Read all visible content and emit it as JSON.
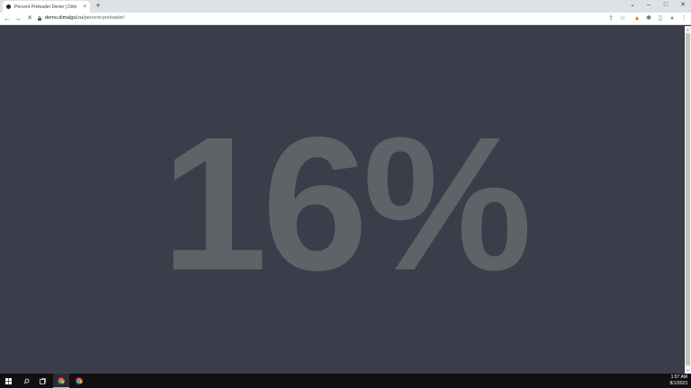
{
  "browser": {
    "tab_title": "Percent Preloader Demo | Dimi",
    "tab_close": "×",
    "new_tab": "+",
    "url_domain": "demo.dimalgul.ru",
    "url_path": "/percent-preloader/",
    "window_controls": {
      "chevron": "⌄",
      "minimize": "–",
      "maximize": "□",
      "close": "✕"
    },
    "nav": {
      "back": "←",
      "forward": "→",
      "stop": "✕"
    },
    "toolbar_icons": {
      "share": "⇪",
      "bookmark": "☆",
      "extension": "▲",
      "puzzle": "✱",
      "sidebar": "▯",
      "profile": "●",
      "menu": "⋮"
    }
  },
  "page": {
    "percent_text": "16%",
    "progress_percent": 16
  },
  "colors": {
    "page_background": "#3a3d4a",
    "percent_text": "#5f6267",
    "taskbar": "#101014"
  },
  "taskbar": {
    "items": [
      "windows-start-icon",
      "search-icon",
      "task-view-icon",
      "chrome-icon",
      "chrome-icon"
    ],
    "time": "1:57 AM",
    "date": "8/1/2023"
  }
}
